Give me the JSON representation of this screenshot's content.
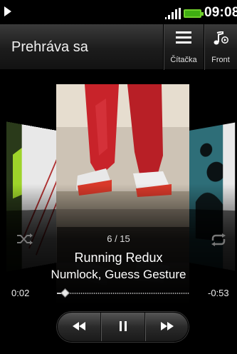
{
  "status_bar": {
    "time": "09:08"
  },
  "header": {
    "title": "Prehráva sa",
    "library_label": "Čítačka",
    "front_label": "Front"
  },
  "track": {
    "position": "6 / 15",
    "title": "Running Redux",
    "artist": "Numlock, Guess Gesture",
    "elapsed": "0:02",
    "remaining": "-0:53",
    "progress_fraction": 0.06
  },
  "colors": {
    "battery": "#3fae12",
    "background": "#000000"
  },
  "icons": [
    "play-status-icon",
    "signal-icon",
    "battery-icon",
    "menu-icon",
    "music-note-icon",
    "shuffle-icon",
    "repeat-icon",
    "rewind-icon",
    "pause-icon",
    "fast-forward-icon"
  ]
}
